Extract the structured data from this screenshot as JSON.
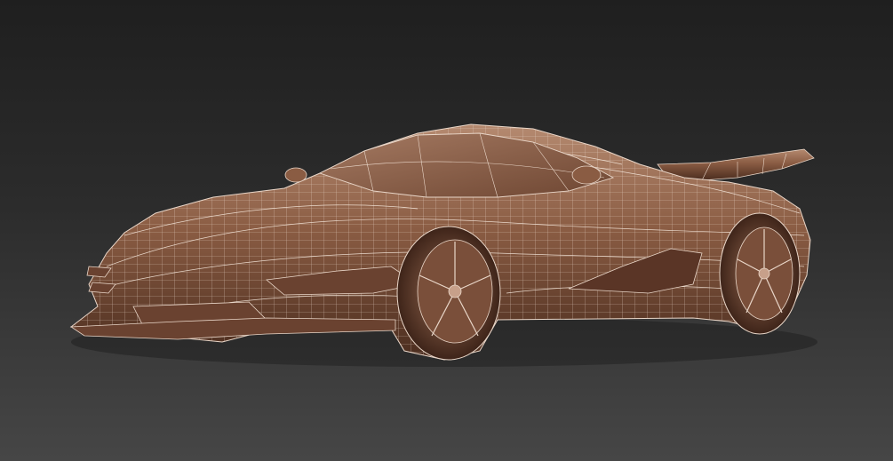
{
  "viewport": {
    "background_top": "#1f1f1f",
    "background_bottom": "#464646"
  },
  "model": {
    "subject": "sports-car-wireframe",
    "shading_mode": "wireframe-over-shaded",
    "surface_color": "#8a5c43",
    "surface_highlight": "#b58a70",
    "surface_shadow": "#4a2c1e",
    "wire_color": "#e9d6c8"
  }
}
